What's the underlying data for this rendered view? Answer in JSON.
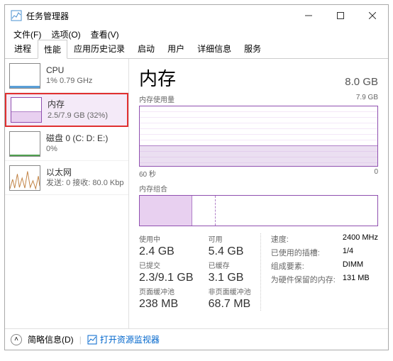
{
  "window": {
    "title": "任务管理器"
  },
  "menu": {
    "file": "文件(F)",
    "options": "选项(O)",
    "view": "查看(V)"
  },
  "tabs": [
    "进程",
    "性能",
    "应用历史记录",
    "启动",
    "用户",
    "详细信息",
    "服务"
  ],
  "sidebar": {
    "items": [
      {
        "title": "CPU",
        "sub": "1% 0.79 GHz"
      },
      {
        "title": "内存",
        "sub": "2.5/7.9 GB (32%)"
      },
      {
        "title": "磁盘 0 (C: D: E:)",
        "sub": "0%"
      },
      {
        "title": "以太网",
        "sub": "发送: 0 接收: 80.0 Kbp"
      }
    ]
  },
  "main": {
    "title": "内存",
    "total": "8.0 GB",
    "usage_label": "内存使用量",
    "usage_max": "7.9 GB",
    "axis_left": "60 秒",
    "axis_right": "0",
    "comp_label": "内存组合",
    "stats": {
      "in_use_label": "使用中",
      "in_use": "2.4 GB",
      "avail_label": "可用",
      "avail": "5.4 GB",
      "committed_label": "已提交",
      "committed": "2.3/9.1 GB",
      "cached_label": "已缓存",
      "cached": "3.1 GB",
      "paged_label": "页面缓冲池",
      "paged": "238 MB",
      "nonpaged_label": "非页面缓冲池",
      "nonpaged": "68.7 MB"
    },
    "right": {
      "speed_k": "速度:",
      "speed_v": "2400 MHz",
      "slots_k": "已使用的插槽:",
      "slots_v": "1/4",
      "form_k": "组成要素:",
      "form_v": "DIMM",
      "hw_k": "为硬件保留的内存:",
      "hw_v": "131 MB"
    }
  },
  "footer": {
    "brief": "简略信息",
    "brief_key": "(D)",
    "monitor": "打开资源监视器"
  }
}
